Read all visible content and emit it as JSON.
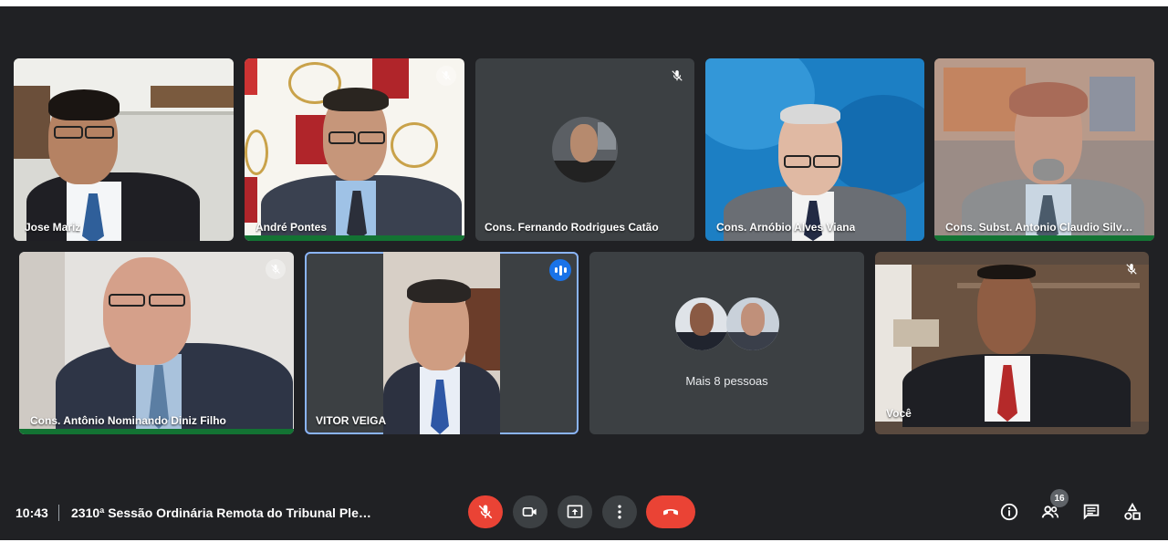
{
  "participants": {
    "jose": {
      "name": "Jose Mariz"
    },
    "andre": {
      "name": "André Pontes"
    },
    "fernando": {
      "name": "Cons. Fernando Rodrigues Catão"
    },
    "arnobio": {
      "name": "Cons. Arnóbio Alves Viana"
    },
    "antonio_claudio": {
      "name": "Cons. Subst. Antonio Claudio Silv…"
    },
    "antonio_nominando": {
      "name": "Cons. Antônio Nominando Diniz Filho"
    },
    "vitor": {
      "name": "VITOR VEIGA"
    },
    "voce": {
      "name": "Você"
    }
  },
  "more_people": {
    "label": "Mais 8 pessoas"
  },
  "bottom_bar": {
    "time": "10:43",
    "meeting_title": "2310ª Sessão Ordinária Remota do Tribunal Ple…",
    "participant_count": "16"
  },
  "colors": {
    "stage_bg": "#202124",
    "tile_bg": "#3c4043",
    "hangup_red": "#ea4335",
    "speaking_blue": "#1a73e8",
    "audio_green": "#137333"
  },
  "icons": {
    "mic_off": "mic-off-icon",
    "camera": "camera-icon",
    "present": "present-screen-icon",
    "more": "more-vert-icon",
    "hangup": "call-end-icon",
    "info": "info-icon",
    "people": "people-icon",
    "chat": "chat-icon",
    "activities": "activities-icon"
  }
}
